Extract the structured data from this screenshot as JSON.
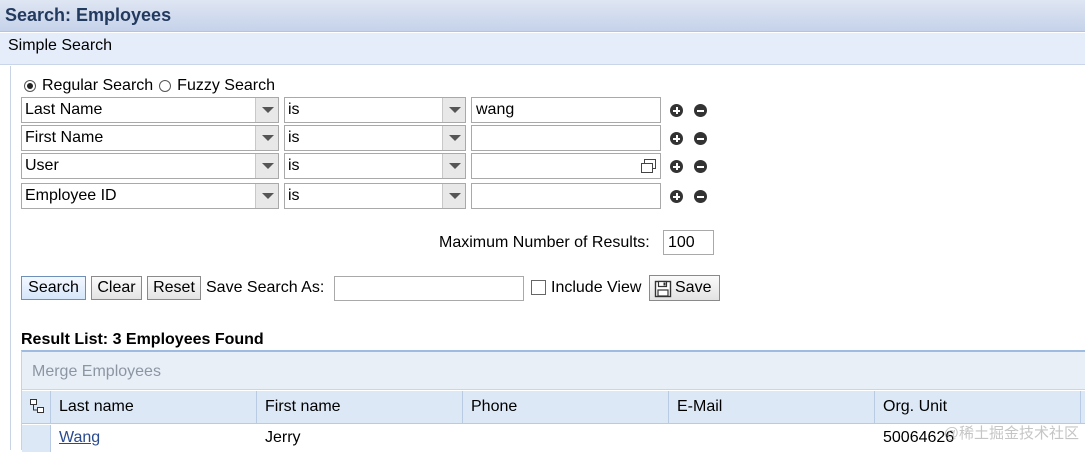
{
  "header": {
    "title": "Search: Employees"
  },
  "subheader": {
    "label": "Simple Search"
  },
  "search_mode": {
    "options": [
      {
        "label": "Regular Search",
        "selected": true
      },
      {
        "label": "Fuzzy Search",
        "selected": false
      }
    ]
  },
  "criteria": [
    {
      "field": "Last Name",
      "operator": "is",
      "value": "wang"
    },
    {
      "field": "First Name",
      "operator": "is",
      "value": ""
    },
    {
      "field": "User",
      "operator": "is",
      "value": ""
    },
    {
      "field": "Employee ID",
      "operator": "is",
      "value": ""
    }
  ],
  "max_results": {
    "label": "Maximum Number of Results:",
    "value": "100"
  },
  "actions": {
    "search": "Search",
    "clear": "Clear",
    "reset": "Reset",
    "save_search_as_label": "Save Search As:",
    "save_search_as_value": "",
    "include_view_label": "Include View",
    "include_view_checked": false,
    "save": "Save"
  },
  "results": {
    "title": "Result List: 3 Employees Found",
    "merge_label": "Merge Employees",
    "columns": [
      "Last name",
      "First name",
      "Phone",
      "E-Mail",
      "Org. Unit"
    ],
    "rows": [
      {
        "last_name": "Wang",
        "first_name": "Jerry",
        "phone": "",
        "email": "",
        "org_unit": "50064626"
      }
    ]
  },
  "watermark": "@稀土掘金技术社区",
  "colors": {
    "title_bar": "#c5d2ea",
    "title_text": "#233a5f",
    "header_row": "#dde8f6",
    "link": "#2a4a8f"
  }
}
